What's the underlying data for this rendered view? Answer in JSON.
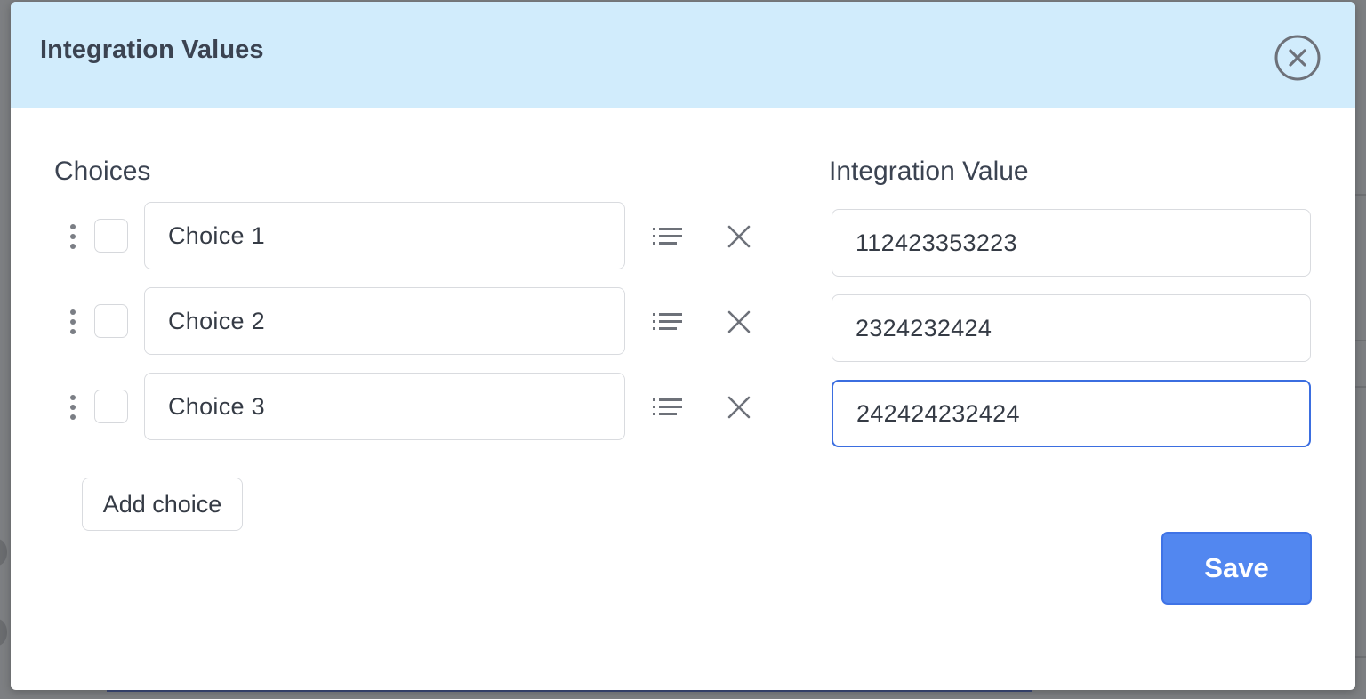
{
  "modal": {
    "title": "Integration Values",
    "close_icon": "close-circle-icon"
  },
  "choices": {
    "label": "Choices",
    "items": [
      {
        "value": "Choice 1"
      },
      {
        "value": "Choice 2"
      },
      {
        "value": "Choice 3"
      }
    ],
    "add_label": "Add choice"
  },
  "integration": {
    "label": "Integration Value",
    "values": [
      {
        "value": "112423353223"
      },
      {
        "value": "2324232424"
      },
      {
        "value": "242424232424"
      }
    ]
  },
  "actions": {
    "save_label": "Save"
  },
  "colors": {
    "header_bg": "#d1ecfc",
    "primary": "#5287f0",
    "focus_border": "#3b6ee0",
    "backdrop": "#7d7f82"
  },
  "icons": {
    "drag": "drag-handle-icon",
    "list": "list-icon",
    "remove": "close-icon"
  }
}
